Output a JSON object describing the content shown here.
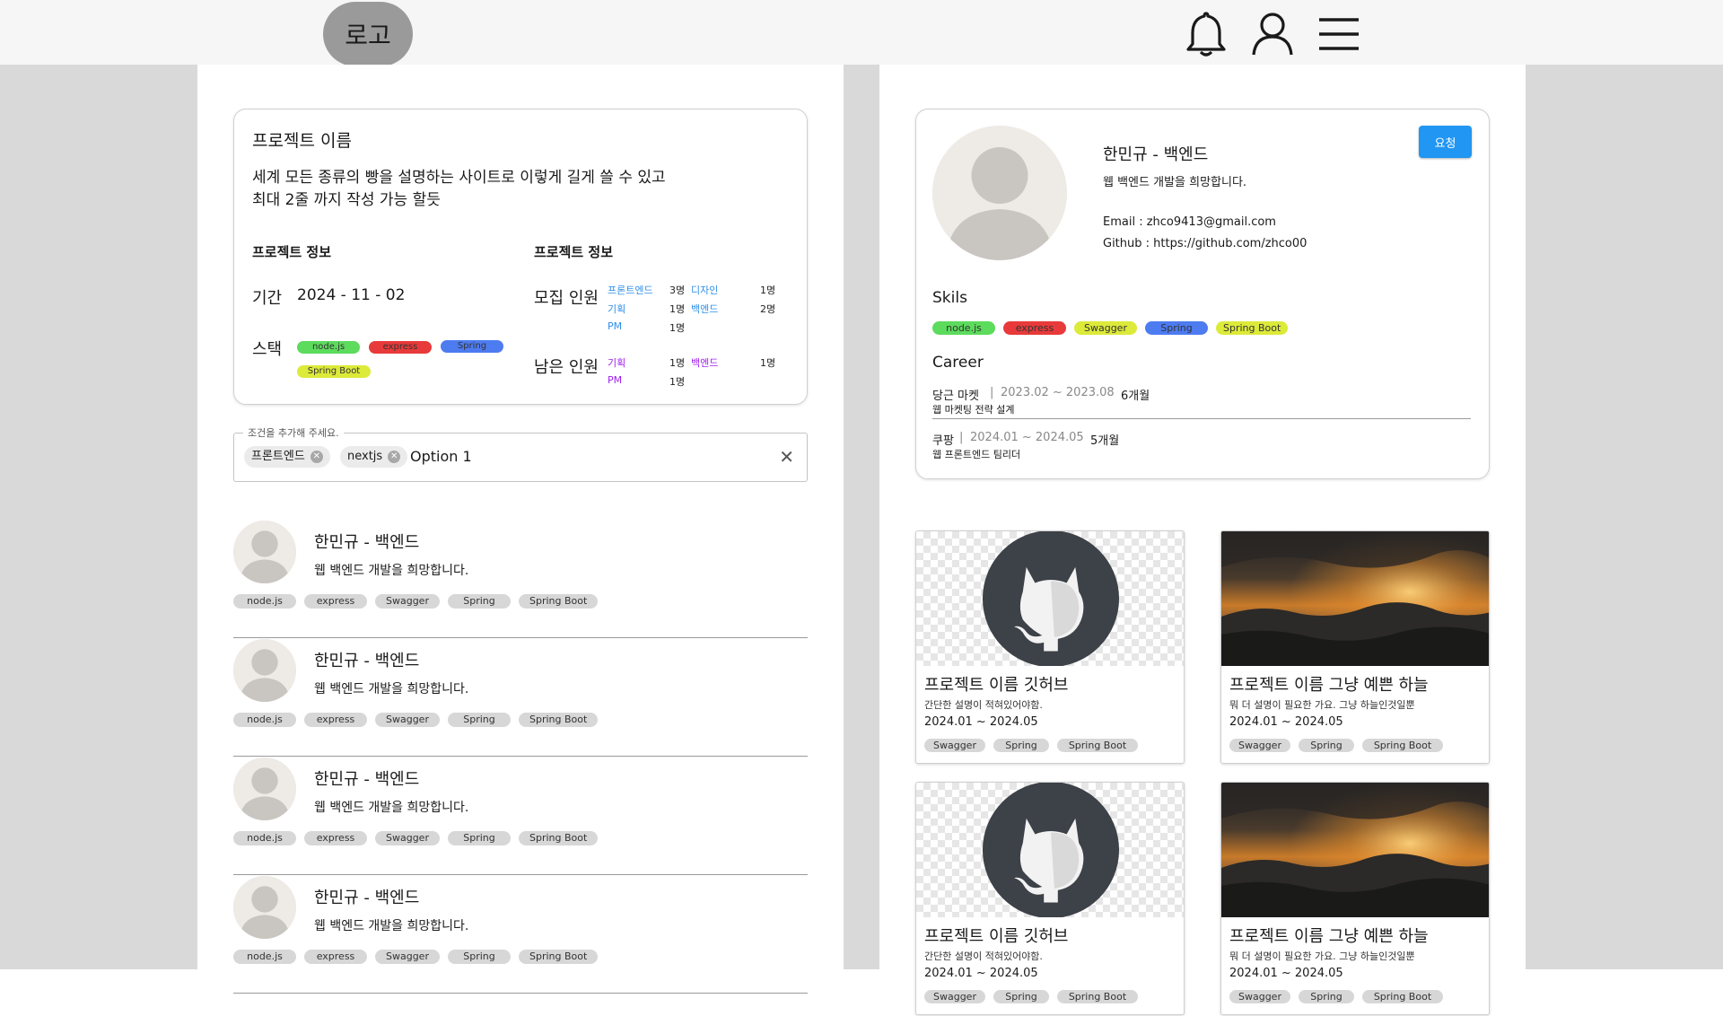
{
  "header": {
    "logo_label": "로고",
    "icons": [
      "bell-icon",
      "user-icon",
      "menu-icon"
    ]
  },
  "colors": {
    "page_bg": "#d9d9d9",
    "primary_button": "#2196f3",
    "tag_green": "#5cdb5c",
    "tag_red": "#e83a3a",
    "tag_blue": "#4d7bf0",
    "tag_yellow": "#dcea3a",
    "tag_gray": "#d7d7d7",
    "link_blue": "#2f8fe8",
    "link_purple": "#a020f0"
  },
  "project": {
    "title": "프로젝트 이름",
    "description": "세계 모든 종류의  빵을 설명하는 사이트로 이렇게 길게 쓸 수 있고\n최대 2줄 까지 작성 가능 할듯",
    "info_left_heading": "프로젝트 정보",
    "info_right_heading": "프로젝트 정보",
    "period_label": "기간",
    "period_value": "2024 - 11 - 02",
    "stack_label": "스택",
    "stack": [
      "node.js",
      "express",
      "Spring",
      "Spring Boot"
    ],
    "recruit_label": "모집 인원",
    "recruit": [
      {
        "role": "프론트엔드",
        "count": "3명",
        "role2": "디자인",
        "count2": "1명"
      },
      {
        "role": "기획",
        "count": "1명",
        "role2": "백엔드",
        "count2": "2명"
      },
      {
        "role": "PM",
        "count": "1명"
      }
    ],
    "remaining_label": "남은 인원",
    "remaining": [
      {
        "role": "기획",
        "count": "1명",
        "role2": "백엔드",
        "count2": "1명"
      },
      {
        "role": "PM",
        "count": "1명"
      }
    ]
  },
  "filter": {
    "legend": "조건을 추가해 주세요.",
    "chips": [
      "프론트엔드",
      "nextjs"
    ],
    "option": "Option 1",
    "clear": "✕"
  },
  "members": [
    {
      "name": "한민규 - 백엔드",
      "desc": "웹 백엔드 개발을 희망합니다.",
      "tags": [
        "node.js",
        "express",
        "Swagger",
        "Spring",
        "Spring Boot"
      ]
    },
    {
      "name": "한민규 - 백엔드",
      "desc": "웹 백엔드 개발을 희망합니다.",
      "tags": [
        "node.js",
        "express",
        "Swagger",
        "Spring",
        "Spring Boot"
      ]
    },
    {
      "name": "한민규 - 백엔드",
      "desc": "웹 백엔드 개발을 희망합니다.",
      "tags": [
        "node.js",
        "express",
        "Swagger",
        "Spring",
        "Spring Boot"
      ]
    },
    {
      "name": "한민규 - 백엔드",
      "desc": "웹 백엔드 개발을 희망합니다.",
      "tags": [
        "node.js",
        "express",
        "Swagger",
        "Spring",
        "Spring Boot"
      ]
    }
  ],
  "profile": {
    "name": "한민규 - 백엔드",
    "desc": "웹 백엔드 개발을 희망합니다.",
    "email": "Email : zhco9413@gmail.com",
    "github": "Github : https://github.com/zhco00",
    "request_label": "요청",
    "skills_heading": "Skils",
    "skills": [
      "node.js",
      "express",
      "Swagger",
      "Spring",
      "Spring Boot"
    ],
    "career_heading": "Career",
    "career": [
      {
        "company": "당근 마켓",
        "sep": "|",
        "period": "2023.02  ~  2023.08",
        "duration": "6개월",
        "role": "웹 마켓팅 전략 설계"
      },
      {
        "company": "쿠팡",
        "sep": "|",
        "period": "2024.01  ~  2024.05",
        "duration": "5개월",
        "role": "웹 프론트엔드 팀리더"
      }
    ]
  },
  "projects": [
    {
      "title": "프로젝트 이름 깃허브",
      "desc": "간단한 설명이 적혀있어야함.",
      "date": "2024.01  ~  2024.05",
      "tags": [
        "Swagger",
        "Spring",
        "Spring Boot"
      ],
      "image": "github-logo"
    },
    {
      "title": "프로젝트 이름 그냥 예쁜 하늘",
      "desc": "뭐 더 설명이 필요한 가요. 그냥 하늘인것일뿐",
      "date": "2024.01  ~  2024.05",
      "tags": [
        "Swagger",
        "Spring",
        "Spring Boot"
      ],
      "image": "sunset-landscape"
    },
    {
      "title": "프로젝트 이름 깃허브",
      "desc": "간단한 설명이 적혀있어야함.",
      "date": "2024.01  ~  2024.05",
      "tags": [
        "Swagger",
        "Spring",
        "Spring Boot"
      ],
      "image": "github-logo"
    },
    {
      "title": "프로젝트 이름 그냥 예쁜 하늘",
      "desc": "뭐 더 설명이 필요한 가요. 그냥 하늘인것일뿐",
      "date": "2024.01  ~  2024.05",
      "tags": [
        "Swagger",
        "Spring",
        "Spring Boot"
      ],
      "image": "sunset-landscape"
    }
  ]
}
